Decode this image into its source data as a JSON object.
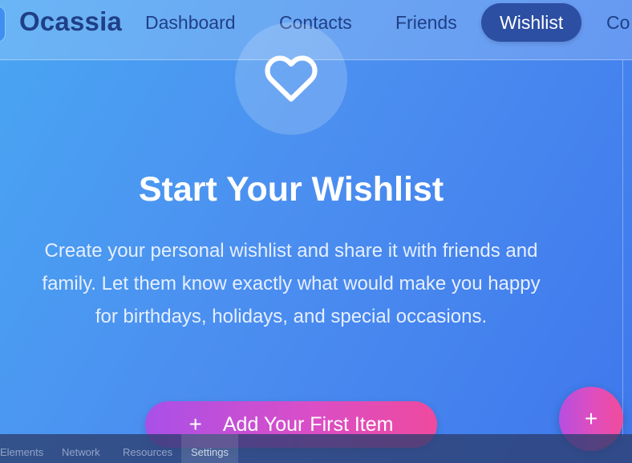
{
  "header": {
    "brand": "Ocassia",
    "nav": [
      {
        "label": "Dashboard"
      },
      {
        "label": "Contacts"
      },
      {
        "label": "Friends"
      },
      {
        "label": "Wishlist",
        "active": true
      },
      {
        "label": "Co"
      }
    ]
  },
  "hero": {
    "icon": "heart-outline-icon",
    "title": "Start Your Wishlist",
    "description": "Create your personal wishlist and share it with friends and family. Let them know exactly what would make you happy for birthdays, holidays, and special occasions.",
    "cta_icon": "+",
    "cta_label": "Add Your First Item"
  },
  "fab": {
    "icon": "+"
  },
  "devtools": {
    "tabs": [
      {
        "label": "Elements"
      },
      {
        "label": "Network"
      },
      {
        "label": "Resources"
      },
      {
        "label": "Settings",
        "active": true
      }
    ]
  },
  "colors": {
    "background_start": "#4aa6f3",
    "background_end": "#3f77ec",
    "nav_text": "#1f3f86",
    "nav_active_bg": "#2c4ea3",
    "cta_gradient_start": "#a950e8",
    "cta_gradient_end": "#ee4a9e"
  }
}
